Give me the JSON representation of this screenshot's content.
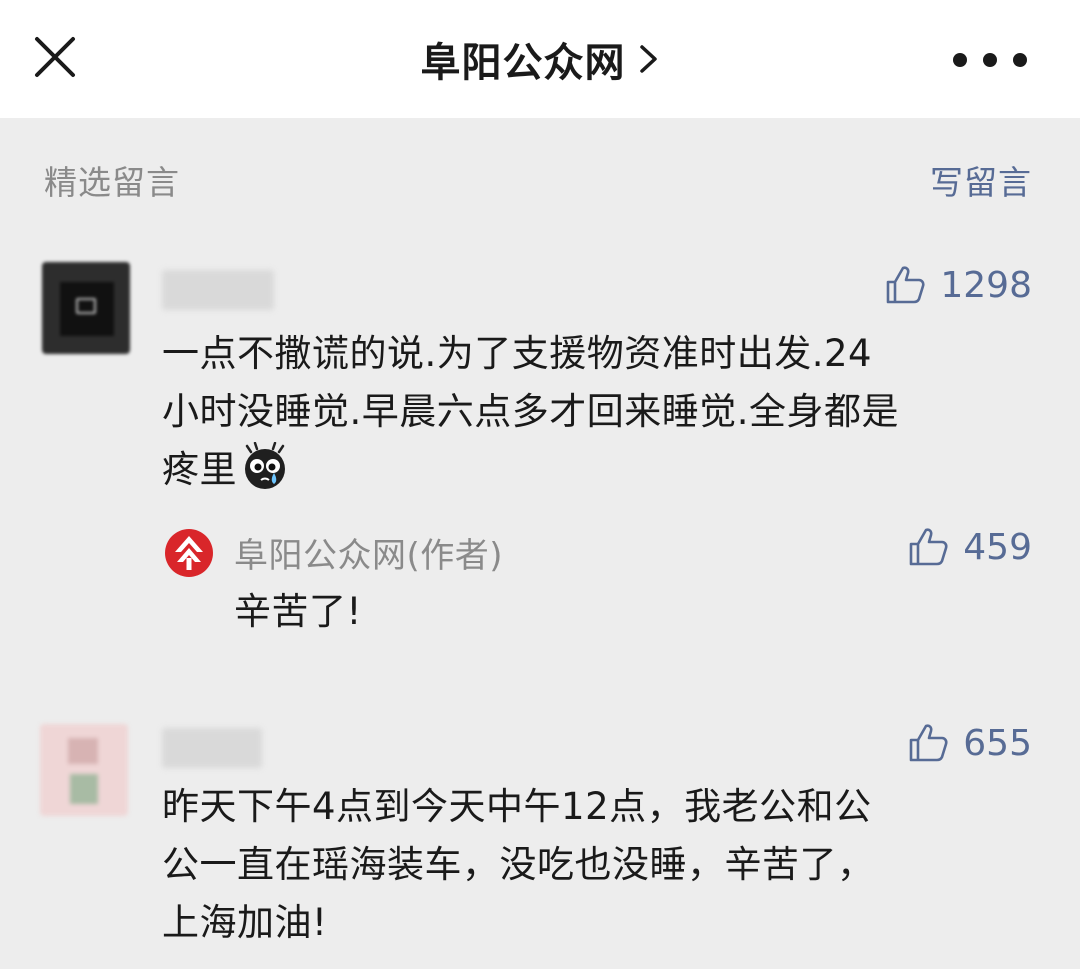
{
  "header": {
    "title": "阜阳公众网"
  },
  "comments_section": {
    "label": "精选留言",
    "write_label": "写留言"
  },
  "comments": [
    {
      "likes": "1298",
      "text": "一点不撒谎的说.为了支援物资准时出发.24\n小时没睡觉.早晨六点多才回来睡觉.全身都是\n疼里",
      "reply": {
        "author": "阜阳公众网(作者)",
        "likes": "459",
        "text": "辛苦了!"
      }
    },
    {
      "likes": "655",
      "text": "昨天下午4点到今天中午12点，我老公和公\n公一直在瑶海装车，没吃也没睡，辛苦了，\n上海加油!"
    }
  ],
  "icons": {
    "close": "close-icon",
    "chevron": "chevron-right-icon",
    "more": "more-dots-icon",
    "like": "thumbs-up-icon",
    "emoji": "crying-emoji-icon",
    "author_logo": "publisher-logo-icon"
  },
  "colors": {
    "link": "#576b95",
    "muted": "#8a8a8a",
    "logo_red": "#d9262a"
  }
}
